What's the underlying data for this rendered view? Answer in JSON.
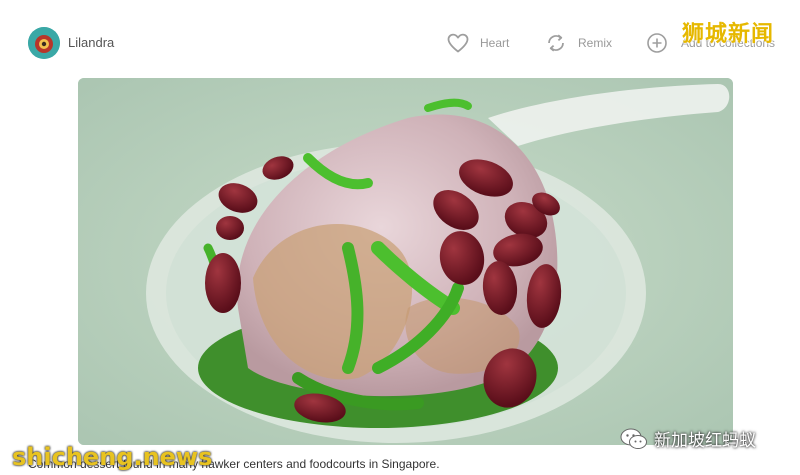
{
  "user": {
    "name": "Lilandra",
    "avatar_icon": "avatar-icon"
  },
  "actions": [
    {
      "label": "Heart",
      "icon": "heart-icon"
    },
    {
      "label": "Remix",
      "icon": "remix-icon"
    },
    {
      "label": "Add to collections",
      "icon": "plus-circle-icon"
    }
  ],
  "photo": {
    "alt": "cendol-dessert-photo"
  },
  "caption": "Common dessert found in many hawker centers and foodcourts in Singapore.",
  "watermarks": {
    "top_right": "狮城新闻",
    "bottom_left": "shicheng.news",
    "bottom_right": "新加坡红蚂蚁",
    "bottom_right_icon": "wechat-icon"
  },
  "colors": {
    "accent_watermark": "#e6b800",
    "icon_gray": "#9e9e9e",
    "avatar_bg": "#3aa8a6"
  }
}
